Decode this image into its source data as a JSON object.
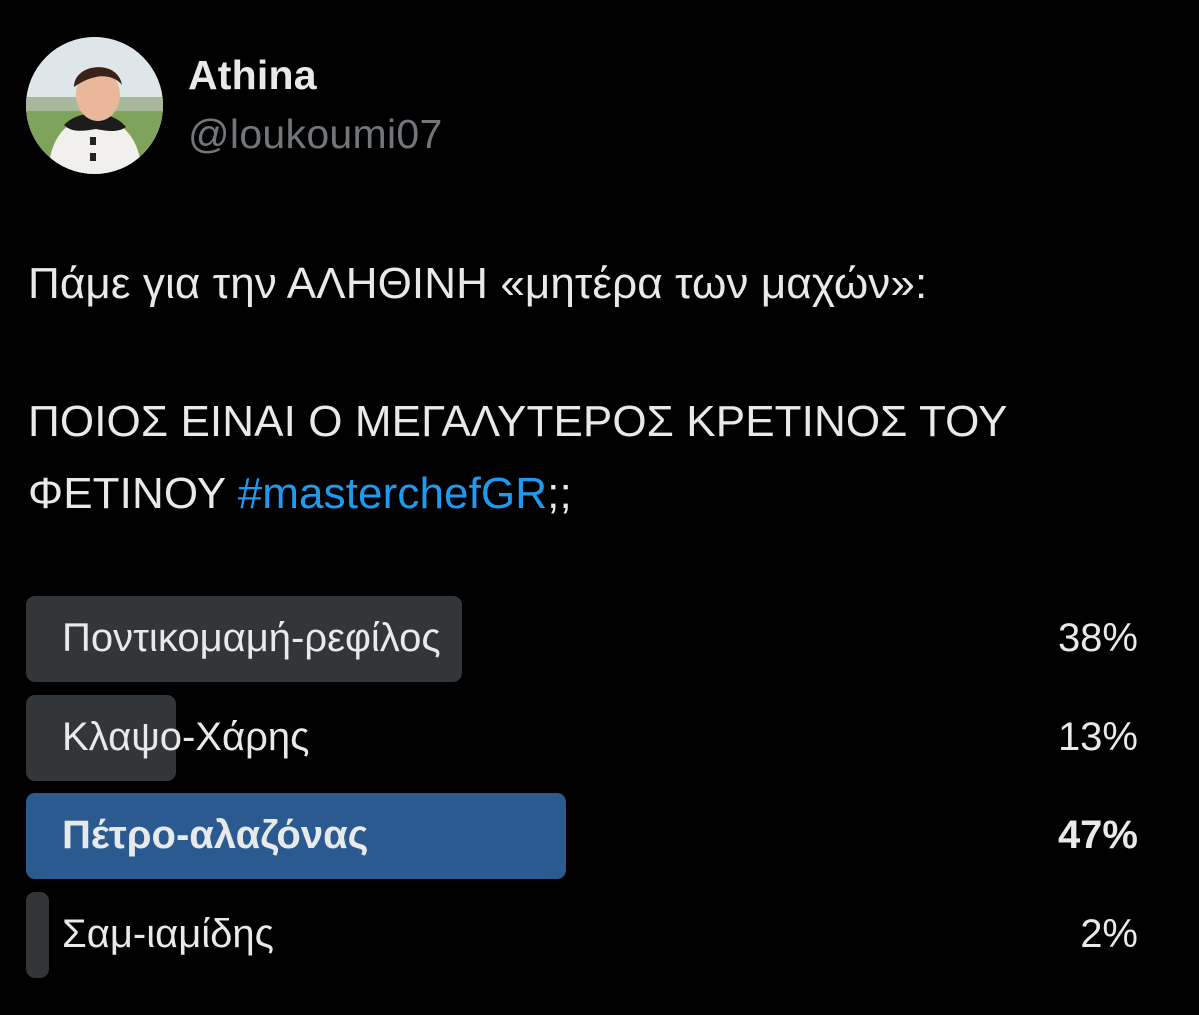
{
  "user": {
    "name": "Athina",
    "handle": "@loukoumi07",
    "avatar_icon": "profile-photo"
  },
  "tweet": {
    "line1": "Πάμε για την ΑΛΗΘΙΝΗ «μητέρα των μαχών»:",
    "line2": "ΠΟΙΟΣ ΕΙΝΑΙ Ο ΜΕΓΑΛΥΤΕΡΟΣ ΚΡΕΤΙΝΟΣ ΤΟΥ",
    "line3_prefix": "ΦΕΤΙΝΟΥ ",
    "hashtag": "#masterchefGR",
    "line3_suffix": ";;"
  },
  "poll": {
    "options": [
      {
        "label": "Ποντικομαμή-ρεφίλος",
        "percent_text": "38%",
        "percent": 38,
        "winner": false
      },
      {
        "label": "Κλαψο-Χάρης",
        "percent_text": "13%",
        "percent": 13,
        "winner": false
      },
      {
        "label": "Πέτρο-αλαζόνας",
        "percent_text": "47%",
        "percent": 47,
        "winner": true
      },
      {
        "label": "Σαμ-ιαμίδης",
        "percent_text": "2%",
        "percent": 2,
        "winner": false
      }
    ]
  },
  "colors": {
    "background": "#000000",
    "text": "#e7e9ea",
    "secondary": "#71767b",
    "link": "#1d9bf0",
    "bar": "#333639",
    "winner_bar": "#2a5a8f"
  }
}
